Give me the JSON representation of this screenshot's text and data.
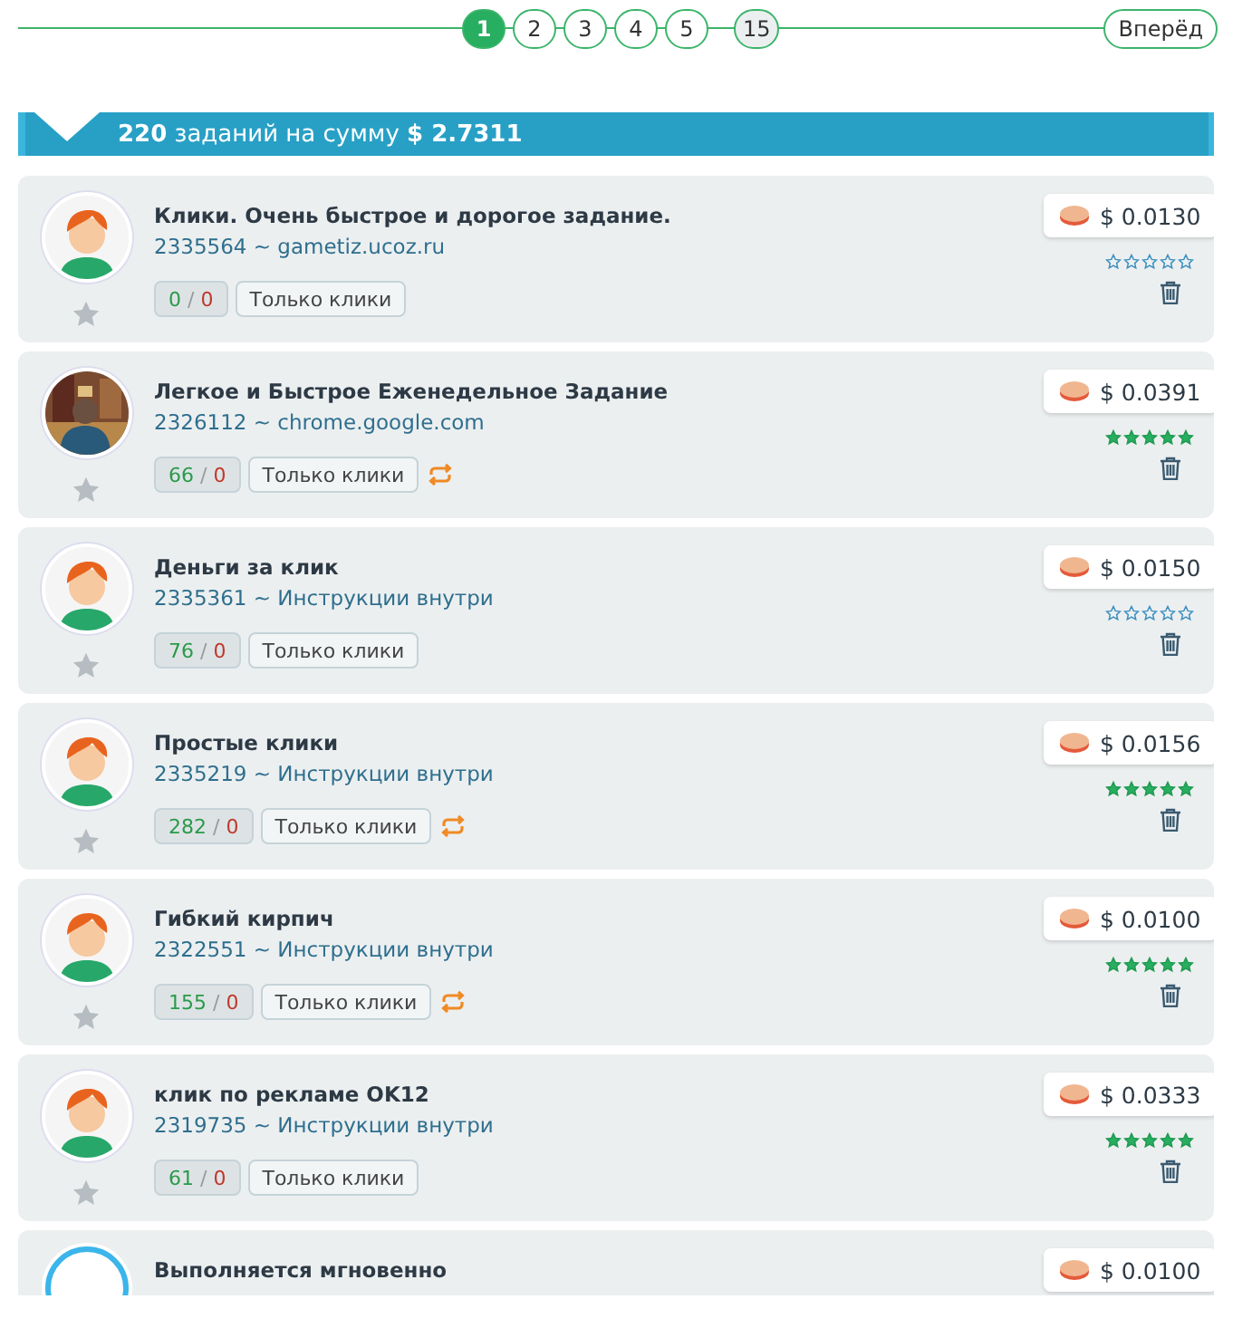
{
  "pagination": {
    "pages": [
      {
        "label": "1",
        "selected": true
      },
      {
        "label": "2",
        "selected": false
      },
      {
        "label": "3",
        "selected": false
      },
      {
        "label": "4",
        "selected": false
      },
      {
        "label": "5",
        "selected": false
      },
      {
        "label": "15",
        "selected": false,
        "kind": "last"
      }
    ],
    "next": "Вперёд"
  },
  "summary": {
    "count": "220",
    "text": "заданий на сумму",
    "amount": "$ 2.7311"
  },
  "tasks": [
    {
      "kind": "figure",
      "title": "Клики. Очень быстрое и дорогое задание.",
      "subtitle": "2335564 ~ gametiz.ucoz.ru",
      "done": "0",
      "divider": "/",
      "failed": "0",
      "tag": "Только клики",
      "repeat": false,
      "price": "$ 0.0130",
      "stars": 0
    },
    {
      "kind": "picture",
      "title": "Легкое и Быстрое Еженедельное Задание",
      "subtitle": "2326112 ~ chrome.google.com",
      "done": "66",
      "divider": "/",
      "failed": "0",
      "tag": "Только клики",
      "repeat": true,
      "price": "$ 0.0391",
      "stars": 5
    },
    {
      "kind": "figure",
      "title": "Деньги за клик",
      "subtitle": "2335361 ~ Инструкции внутри",
      "done": "76",
      "divider": "/",
      "failed": "0",
      "tag": "Только клики",
      "repeat": false,
      "price": "$ 0.0150",
      "stars": 0
    },
    {
      "kind": "figure",
      "title": "Простые клики",
      "subtitle": "2335219 ~ Инструкции внутри",
      "done": "282",
      "divider": "/",
      "failed": "0",
      "tag": "Только клики",
      "repeat": true,
      "price": "$ 0.0156",
      "stars": 5
    },
    {
      "kind": "figure",
      "title": "Гибкий кирпич",
      "subtitle": "2322551 ~ Инструкции внутри",
      "done": "155",
      "divider": "/",
      "failed": "0",
      "tag": "Только клики",
      "repeat": true,
      "price": "$ 0.0100",
      "stars": 5
    },
    {
      "kind": "figure",
      "title": "клик по рекламе OK12",
      "subtitle": "2319735 ~ Инструкции внутри",
      "done": "61",
      "divider": "/",
      "failed": "0",
      "tag": "Только клики",
      "repeat": false,
      "price": "$ 0.0333",
      "stars": 5
    },
    {
      "kind": "ring",
      "title": "Выполняется мгновенно",
      "price": "$ 0.0100"
    }
  ]
}
